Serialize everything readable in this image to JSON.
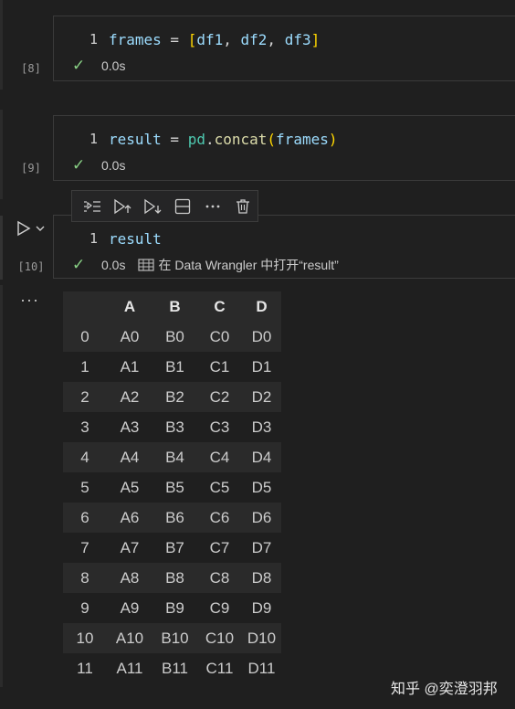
{
  "cells": [
    {
      "exec_count": "[8]",
      "line_no": "1",
      "tokens": [
        "frames",
        " = ",
        "[",
        "df1",
        ", ",
        "df2",
        ", ",
        "df3",
        "]"
      ],
      "status_time": "0.0s"
    },
    {
      "exec_count": "[9]",
      "line_no": "1",
      "tokens": [
        "result",
        " = ",
        "pd",
        ".",
        "concat",
        "(",
        "frames",
        ")"
      ],
      "status_time": "0.0s"
    },
    {
      "exec_count": "[10]",
      "line_no": "1",
      "tokens": [
        "result"
      ],
      "status_time": "0.0s",
      "wrangler_label": "在 Data Wrangler 中打开“result”"
    }
  ],
  "toolbar": {
    "icons": [
      "run-by-line-icon",
      "execute-above-icon",
      "execute-below-icon",
      "split-cell-icon",
      "more-icon",
      "delete-icon"
    ]
  },
  "output": {
    "more_label": "···",
    "columns": [
      "",
      "A",
      "B",
      "C",
      "D"
    ],
    "rows": [
      [
        "0",
        "A0",
        "B0",
        "C0",
        "D0"
      ],
      [
        "1",
        "A1",
        "B1",
        "C1",
        "D1"
      ],
      [
        "2",
        "A2",
        "B2",
        "C2",
        "D2"
      ],
      [
        "3",
        "A3",
        "B3",
        "C3",
        "D3"
      ],
      [
        "4",
        "A4",
        "B4",
        "C4",
        "D4"
      ],
      [
        "5",
        "A5",
        "B5",
        "C5",
        "D5"
      ],
      [
        "6",
        "A6",
        "B6",
        "C6",
        "D6"
      ],
      [
        "7",
        "A7",
        "B7",
        "C7",
        "D7"
      ],
      [
        "8",
        "A8",
        "B8",
        "C8",
        "D8"
      ],
      [
        "9",
        "A9",
        "B9",
        "C9",
        "D9"
      ],
      [
        "10",
        "A10",
        "B10",
        "C10",
        "D10"
      ],
      [
        "11",
        "A11",
        "B11",
        "C11",
        "D11"
      ]
    ]
  },
  "watermark": "知乎 @奕澄羽邦",
  "colors": {
    "check": "#89d185",
    "variable": "#9cdcfe",
    "function": "#dcdcaa",
    "bracket": "#ffd700",
    "module": "#4ec9b0"
  }
}
